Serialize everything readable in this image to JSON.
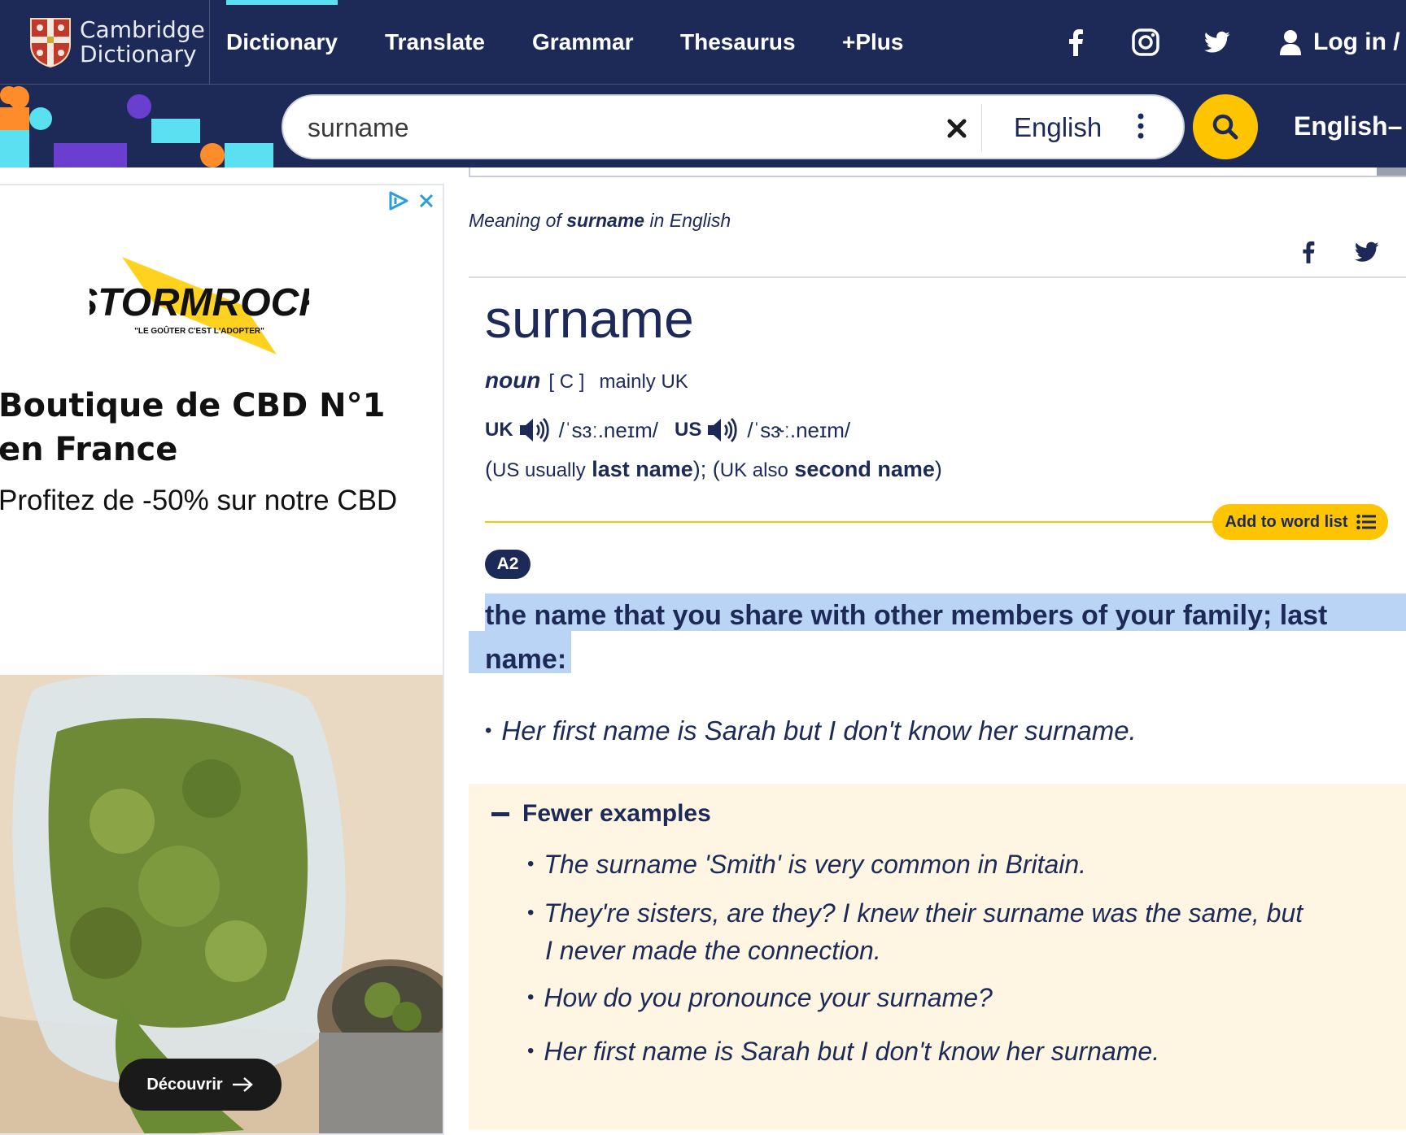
{
  "brand": {
    "line1": "Cambridge",
    "line2": "Dictionary"
  },
  "nav": [
    {
      "label": "Dictionary"
    },
    {
      "label": "Translate"
    },
    {
      "label": "Grammar"
    },
    {
      "label": "Thesaurus"
    },
    {
      "label": "+Plus"
    }
  ],
  "social_icons": [
    "facebook-icon",
    "instagram-icon",
    "twitter-icon"
  ],
  "login": {
    "label": "Log in /"
  },
  "search": {
    "value": "surname",
    "language": "English",
    "dictionary": "English–"
  },
  "ad": {
    "brand": "STORMROCK",
    "tagline": "\"LE GOÛTER C'EST L'ADOPTER\"",
    "heading": "Boutique de CBD N°1 en France",
    "text": "Profitez de -50% sur notre CBD",
    "cta": "Découvrir"
  },
  "entry": {
    "meaning_prefix": "Meaning of",
    "meaning_word": "surname",
    "meaning_suffix": "in English",
    "headword": "surname",
    "pos": "noun",
    "grammar": "[ C ]",
    "usage": "mainly UK",
    "uk_label": "UK",
    "uk_ipa": "/ˈsɜː.neɪm/",
    "us_label": "US",
    "us_ipa": "/ˈsɝː.neɪm/",
    "variants": {
      "open": "(",
      "us_label": "US usually",
      "us_word": "last name",
      "mid": "); (",
      "uk_label": "UK also",
      "uk_word": "second name",
      "close": ")"
    },
    "add_to_word_list": "Add to word list",
    "level": "A2",
    "definition": "the name that you share with other members of your family; last name:",
    "example": "Her first name is Sarah but I don't know her surname.",
    "fewer_examples": "Fewer examples",
    "more_examples": [
      "The surname 'Smith' is very common in Britain.",
      "They're sisters, are they? I knew their surname was the same, but I never made the connection.",
      "How do you pronounce your surname?",
      "Her first name is Sarah but I don't know her surname."
    ]
  },
  "colors": {
    "navy": "#1d2a57",
    "yellow": "#fec400",
    "cyan": "#5be0f2",
    "highlight": "#b9d4f4",
    "example_bg": "#fef6e2"
  }
}
